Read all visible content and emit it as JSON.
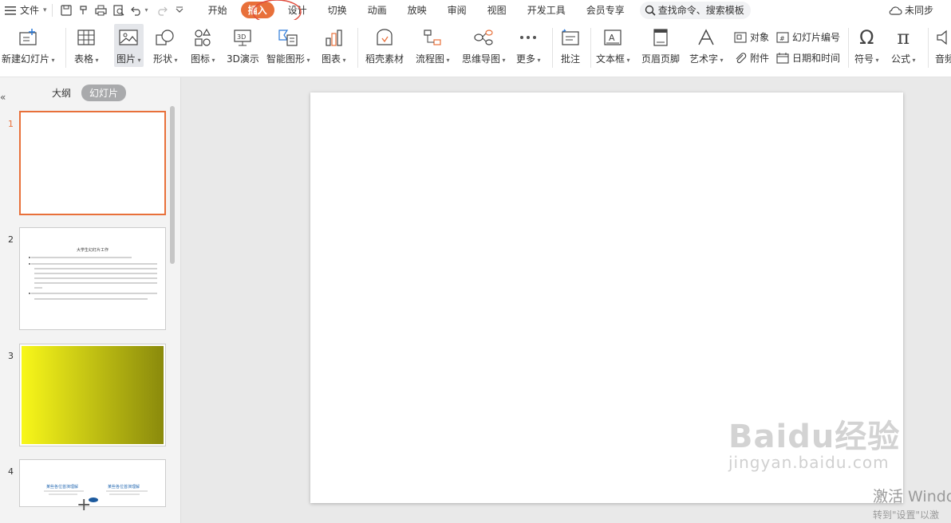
{
  "menubar": {
    "file_label": "文件",
    "tabs": [
      "开始",
      "插入",
      "设计",
      "切换",
      "动画",
      "放映",
      "审阅",
      "视图",
      "开发工具",
      "会员专享"
    ],
    "active_tab": "插入",
    "search_label": "查找命令、搜索模板",
    "sync_label": "未同步"
  },
  "ribbon": {
    "new_slide": "新建幻灯片",
    "table": "表格",
    "picture": "图片",
    "shape": "形状",
    "icon": "图标",
    "demo3d": "3D演示",
    "smartart": "智能图形",
    "chart": "图表",
    "material": "稻壳素材",
    "flowchart": "流程图",
    "mindmap": "思维导图",
    "more": "更多",
    "comment": "批注",
    "textbox": "文本框",
    "header_footer": "页眉页脚",
    "wordart": "艺术字",
    "object": "对象",
    "attachment": "附件",
    "slide_number": "幻灯片编号",
    "datetime": "日期和时间",
    "symbol": "符号",
    "formula": "公式",
    "audio": "音频"
  },
  "panel": {
    "tab_outline": "大纲",
    "tab_slides": "幻灯片",
    "slide_numbers": [
      "1",
      "2",
      "3",
      "4"
    ],
    "slide2_title": "大学生幻灯片工作",
    "slide4_col1_title": "某些各位首演理解",
    "slide4_col2_title": "某些各位首演理解"
  },
  "watermark": {
    "brand": "Baidu经验",
    "url": "jingyan.baidu.com",
    "activate_line1": "激活 Windo",
    "activate_line2": "转到\"设置\"以激"
  },
  "colors": {
    "accent": "#e8703a",
    "slide3_gradient_start": "#f8f71a",
    "slide3_gradient_end": "#8a8a0c"
  }
}
